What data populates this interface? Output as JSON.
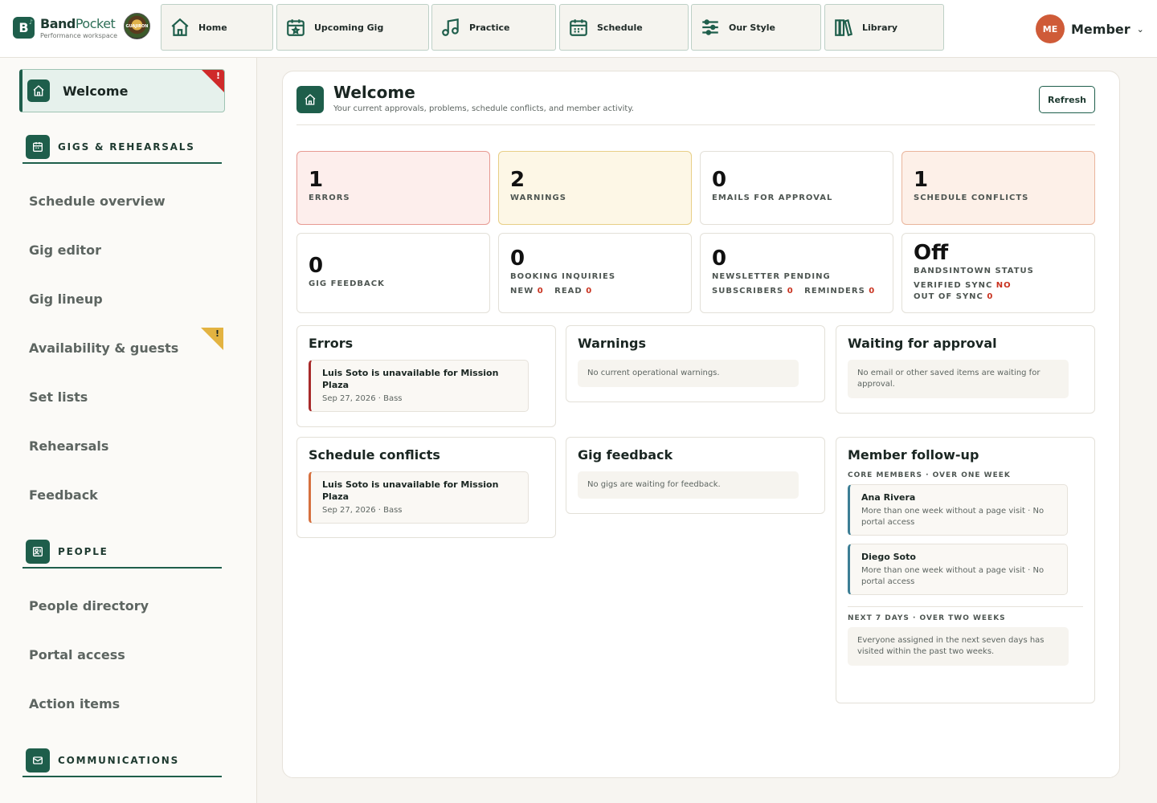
{
  "brand": {
    "name_bold": "Band",
    "name_light": "Pocket",
    "subtitle": "Performance workspace",
    "mark": "B",
    "badge_text": "GUAJIRON"
  },
  "nav": {
    "tabs": [
      {
        "label": "Home",
        "icon": "home-icon"
      },
      {
        "label": "Upcoming Gig",
        "icon": "calendar-star-icon"
      },
      {
        "label": "Practice",
        "icon": "music-notes-icon"
      },
      {
        "label": "Schedule",
        "icon": "calendar-icon"
      },
      {
        "label": "Our Style",
        "icon": "sliders-icon"
      },
      {
        "label": "Library",
        "icon": "books-icon"
      }
    ]
  },
  "member": {
    "initials": "ME",
    "name": "Member",
    "caret": "⌄"
  },
  "sidebar": {
    "welcome": {
      "label": "Welcome",
      "alert": "!"
    },
    "sections": [
      {
        "label": "GIGS & REHEARSALS",
        "icon": "calendar-icon"
      },
      {
        "label": "PEOPLE",
        "icon": "id-card-icon"
      },
      {
        "label": "COMMUNICATIONS",
        "icon": "mail-icon"
      }
    ],
    "gigs_items": [
      "Schedule overview",
      "Gig editor",
      "Gig lineup",
      "Availability & guests",
      "Set lists",
      "Rehearsals",
      "Feedback"
    ],
    "people_items": [
      "People directory",
      "Portal access",
      "Action items"
    ],
    "availability_alert": "!"
  },
  "header": {
    "title": "Welcome",
    "subtitle": "Your current approvals, problems, schedule conflicts, and member activity.",
    "refresh_label": "Refresh"
  },
  "stats": {
    "errors": {
      "value": "1",
      "label": "ERRORS"
    },
    "warnings": {
      "value": "2",
      "label": "WARNINGS"
    },
    "emails": {
      "value": "0",
      "label": "EMAILS FOR APPROVAL"
    },
    "conflicts": {
      "value": "1",
      "label": "SCHEDULE CONFLICTS"
    },
    "gig_feedback": {
      "value": "0",
      "label": "GIG FEEDBACK"
    },
    "booking": {
      "value": "0",
      "label": "BOOKING INQUIRIES",
      "new_label": "NEW",
      "new_value": "0",
      "read_label": "READ",
      "read_value": "0"
    },
    "newsletter": {
      "value": "0",
      "label": "NEWSLETTER PENDING",
      "subs_label": "SUBSCRIBERS",
      "subs_value": "0",
      "rem_label": "REMINDERS",
      "rem_value": "0"
    },
    "bandsintown": {
      "value": "Off",
      "label": "BANDSINTOWN STATUS",
      "verified_label": "VERIFIED SYNC",
      "verified_value": "NO",
      "out_label": "OUT OF SYNC",
      "out_value": "0"
    }
  },
  "cards": {
    "errors": {
      "title": "Errors",
      "item_title": "Luis Soto is unavailable for Mission Plaza",
      "item_meta": "Sep 27, 2026 · Bass"
    },
    "warnings": {
      "title": "Warnings",
      "empty": "No current operational warnings."
    },
    "approval": {
      "title": "Waiting for approval",
      "empty": "No email or other saved items are waiting for approval."
    },
    "conflicts": {
      "title": "Schedule conflicts",
      "item_title": "Luis Soto is unavailable for Mission Plaza",
      "item_meta": "Sep 27, 2026 · Bass"
    },
    "feedback": {
      "title": "Gig feedback",
      "empty": "No gigs are waiting for feedback."
    },
    "followup": {
      "title": "Member follow-up",
      "core_heading": "CORE MEMBERS · OVER ONE WEEK",
      "members": [
        {
          "name": "Ana Rivera",
          "meta": "More than one week without a page visit · No portal access"
        },
        {
          "name": "Diego Soto",
          "meta": "More than one week without a page visit · No portal access"
        }
      ],
      "next_heading": "NEXT 7 DAYS · OVER TWO WEEKS",
      "next_empty": "Everyone assigned in the next seven days has visited within the past two weeks."
    }
  },
  "colors": {
    "brand_green": "#1e5e4b",
    "error_red": "#c9321f",
    "avatar_orange": "#cf5b38",
    "warning_yellow": "#e3b341"
  }
}
